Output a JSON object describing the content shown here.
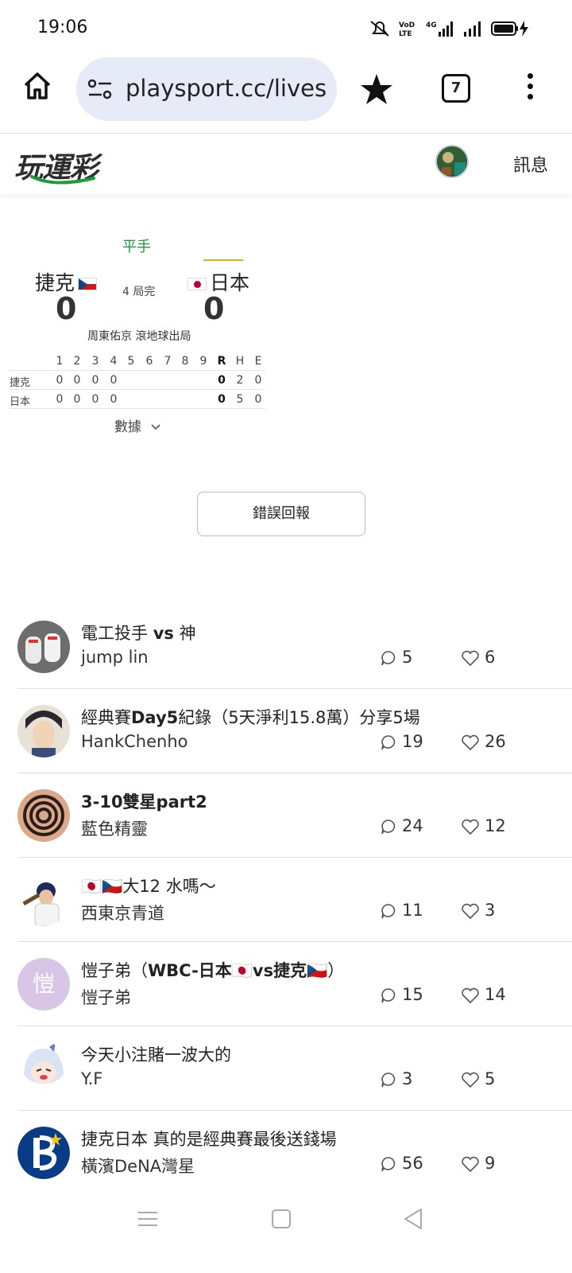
{
  "status_bar": {
    "time": "19:06"
  },
  "browser": {
    "url": "playsport.cc/lives",
    "tab_count": "7"
  },
  "site_header": {
    "logo_text": "玩運彩",
    "messages_label": "訊息"
  },
  "game": {
    "result_label": "平手",
    "away_team": "捷克",
    "home_team": "日本",
    "away_score": "0",
    "home_score": "0",
    "inning_status": "4 局完",
    "last_play": "周東佑京 滾地球出局",
    "stats_label": "數據",
    "line_score": {
      "headers": [
        "1",
        "2",
        "3",
        "4",
        "5",
        "6",
        "7",
        "8",
        "9",
        "R",
        "H",
        "E"
      ],
      "rows": [
        {
          "team": "捷克",
          "innings": [
            "0",
            "0",
            "0",
            "0",
            "",
            "",
            "",
            "",
            ""
          ],
          "R": "0",
          "H": "2",
          "E": "0"
        },
        {
          "team": "日本",
          "innings": [
            "0",
            "0",
            "0",
            "0",
            "",
            "",
            "",
            "",
            ""
          ],
          "R": "0",
          "H": "5",
          "E": "0"
        }
      ]
    }
  },
  "report_button_label": "錯誤回報",
  "posts": [
    {
      "title_pre": "電工投手 ",
      "title_bold": "vs",
      "title_post": " 神",
      "author": "jump lin",
      "comments": "5",
      "likes": "6",
      "avatar": "shoes"
    },
    {
      "title_pre": "經典賽",
      "title_bold": "Day5",
      "title_post": "紀錄（5天淨利15.8萬）分享5場",
      "author": "HankChenho",
      "comments": "19",
      "likes": "26",
      "avatar": "anime-man"
    },
    {
      "title_pre": "",
      "title_bold": "3-10雙星part2",
      "title_post": "",
      "author": "藍色精靈",
      "comments": "24",
      "likes": "12",
      "avatar": "spiral"
    },
    {
      "title_pre": "🇯🇵🇨🇿大12 水嗎～",
      "title_bold": "",
      "title_post": "",
      "author": "西東京青道",
      "comments": "11",
      "likes": "3",
      "avatar": "baseball-player"
    },
    {
      "title_pre": "愷子弟（",
      "title_bold": "WBC-日本🇯🇵vs捷克🇨🇿",
      "title_post": "）",
      "author": "愷子弟",
      "comments": "15",
      "likes": "14",
      "avatar": "letter",
      "avatar_letter": "愷"
    },
    {
      "title_pre": "今天小注賭一波大的",
      "title_bold": "",
      "title_post": "",
      "author": "Y.F",
      "comments": "3",
      "likes": "5",
      "avatar": "anime-girl"
    },
    {
      "title_pre": "捷克日本 真的是經典賽最後送錢場",
      "title_bold": "",
      "title_post": "",
      "author": "橫濱DeNA灣星",
      "comments": "56",
      "likes": "9",
      "avatar": "baystars-logo"
    }
  ],
  "colors": {
    "accent_green": "#1a9c3a",
    "url_pill_bg": "#e6ebf7",
    "home_bar": "#e0b020"
  }
}
